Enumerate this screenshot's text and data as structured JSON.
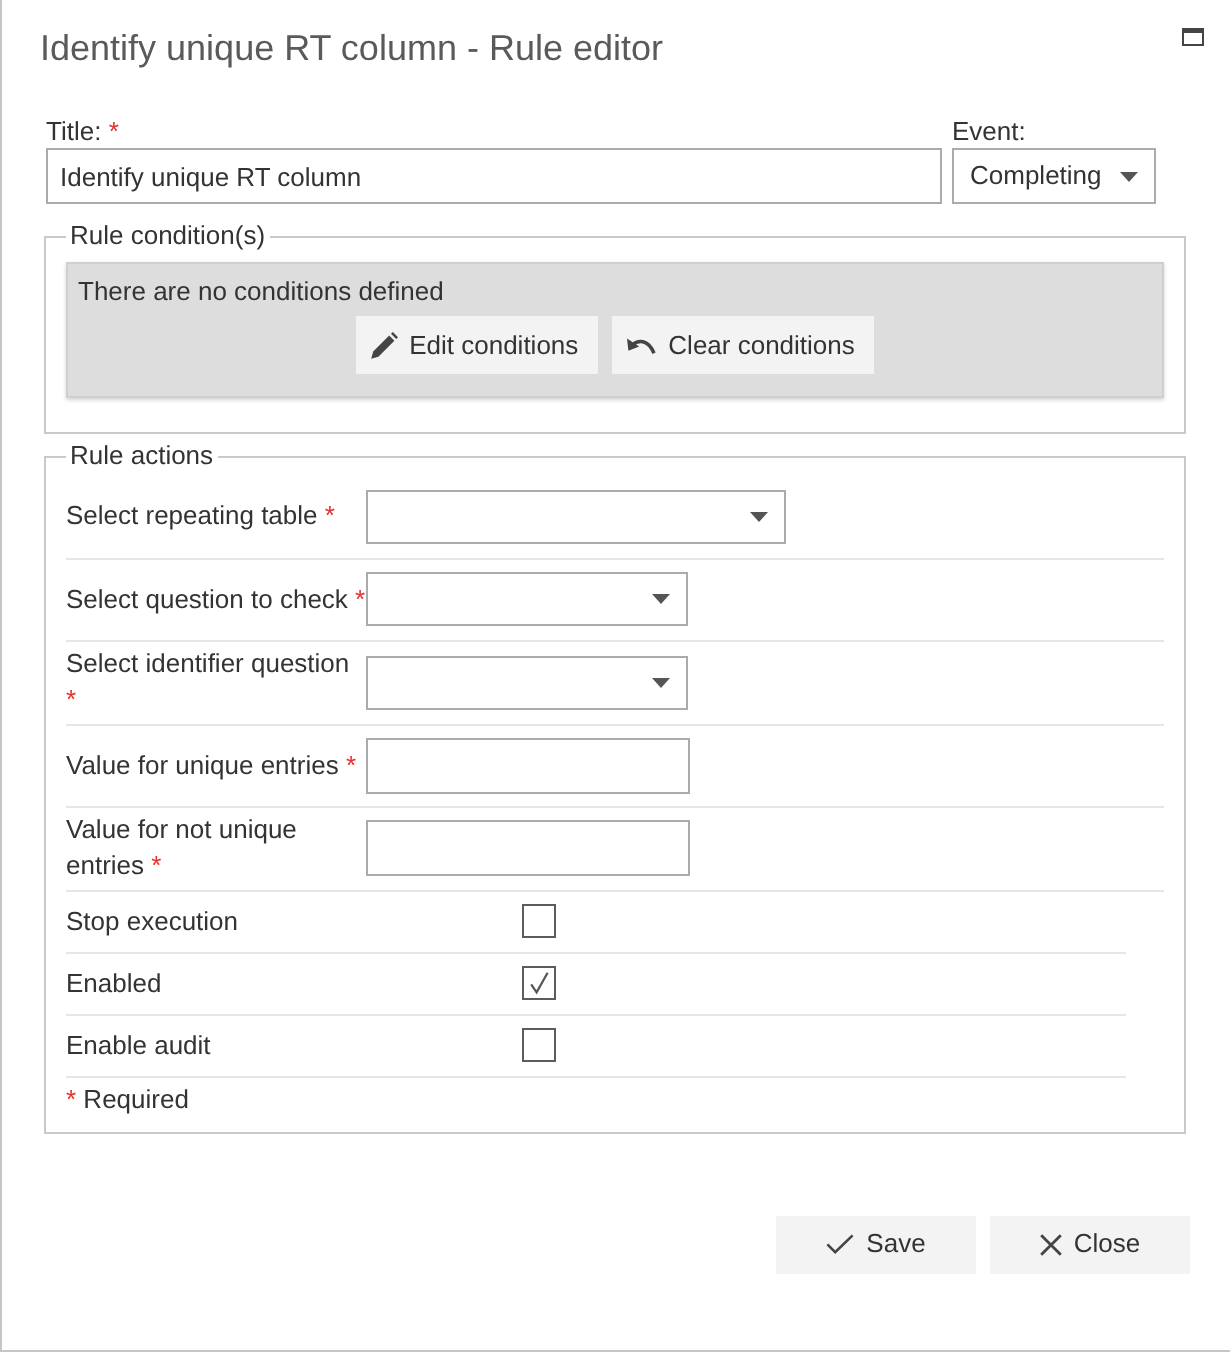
{
  "window": {
    "title": "Identify unique RT column - Rule editor"
  },
  "title_field": {
    "label": "Title:",
    "required_mark": "*",
    "value": "Identify unique RT column"
  },
  "event_field": {
    "label": "Event:",
    "value": "Completing"
  },
  "rule_conditions": {
    "legend": "Rule condition(s)",
    "message": "There are no conditions defined",
    "buttons": [
      "Edit conditions",
      "Clear conditions"
    ]
  },
  "rule_actions": {
    "legend": "Rule actions",
    "rows": [
      {
        "kind": "dropdown",
        "label": "Select repeating table",
        "required_mark": "*"
      },
      {
        "kind": "dropdown",
        "label": "Select question to check",
        "required_mark": "*"
      },
      {
        "kind": "dropdown",
        "label": "Select identifier question",
        "required_mark": "*"
      },
      {
        "kind": "text",
        "label": "Value for unique entries",
        "required_mark": "*"
      },
      {
        "kind": "text",
        "label": "Value for not unique entries",
        "required_mark": "*"
      },
      {
        "kind": "checkbox",
        "label": "Stop execution",
        "checked": false
      },
      {
        "kind": "checkbox",
        "label": "Enabled",
        "checked": true
      },
      {
        "kind": "checkbox",
        "label": "Enable audit",
        "checked": false
      }
    ],
    "footnote": {
      "mark": "*",
      "text": "Required"
    }
  },
  "buttons": [
    "Save",
    "Close"
  ]
}
